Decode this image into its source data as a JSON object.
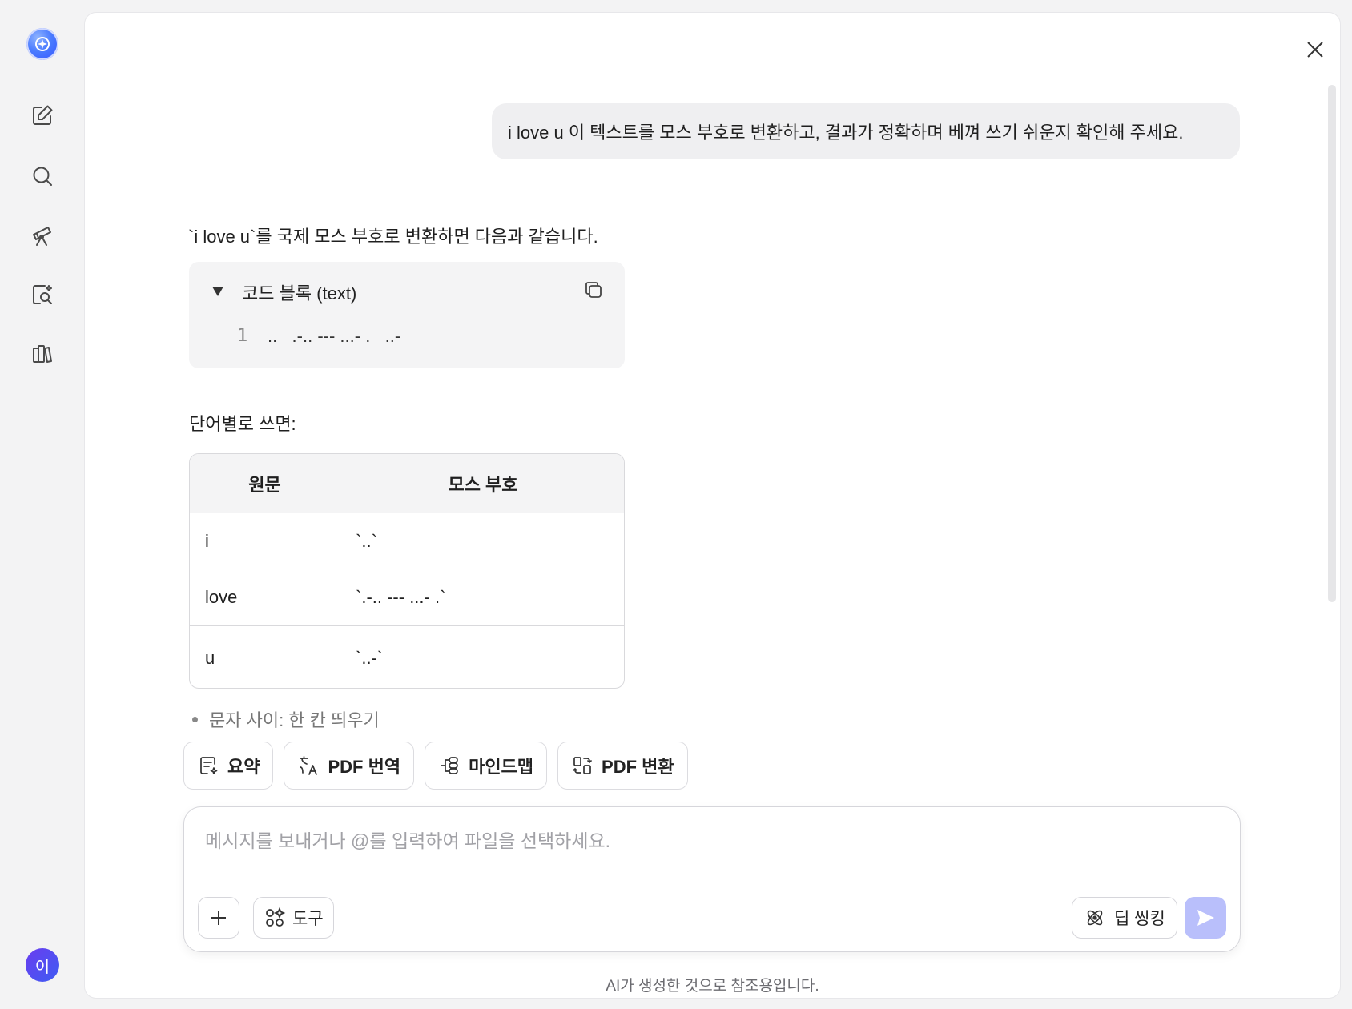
{
  "rail": {
    "items": [
      {
        "name": "new-chat",
        "icon": "edit-icon"
      },
      {
        "name": "search",
        "icon": "search-icon"
      },
      {
        "name": "explore",
        "icon": "telescope-icon"
      },
      {
        "name": "research",
        "icon": "doc-search-icon"
      },
      {
        "name": "library",
        "icon": "books-icon"
      }
    ],
    "avatar_label": "이"
  },
  "conversation": {
    "user_message": "i love u 이 텍스트를 모스 부호로 변환하고, 결과가 정확하며 베껴 쓰기 쉬운지 확인해 주세요.",
    "answer": {
      "intro": "`i love u`를 국제 모스 부호로 변환하면 다음과 같습니다.",
      "code_block": {
        "title": "코드 블록 (text)",
        "line_number": "1",
        "code": "..   .-.. --- ...- .   ..-"
      },
      "by_word_label": "단어별로 쓰면:",
      "table": {
        "headers": [
          "원문",
          "모스 부호"
        ],
        "rows": [
          [
            "i",
            "`..`"
          ],
          [
            "love",
            "`.-.. --- ...- .`"
          ],
          [
            "u",
            "`..-`"
          ]
        ]
      },
      "bullet": "문자 사이: 한 칸 띄우기"
    }
  },
  "quick_actions": [
    {
      "label": "요약",
      "icon": "summary-icon"
    },
    {
      "label": "PDF 번역",
      "icon": "translate-icon"
    },
    {
      "label": "마인드맵",
      "icon": "mindmap-icon"
    },
    {
      "label": "PDF 변환",
      "icon": "convert-icon"
    }
  ],
  "composer": {
    "placeholder": "메시지를 보내거나 @를 입력하여 파일을 선택하세요.",
    "tools_label": "도구",
    "deep_thinking_label": "딥 씽킹"
  },
  "disclaimer": "AI가 생성한 것으로 참조용입니다.",
  "colors": {
    "accent": "#4a6cf7",
    "send_disabled": "#b9bffb",
    "bubble": "#efeff1"
  }
}
